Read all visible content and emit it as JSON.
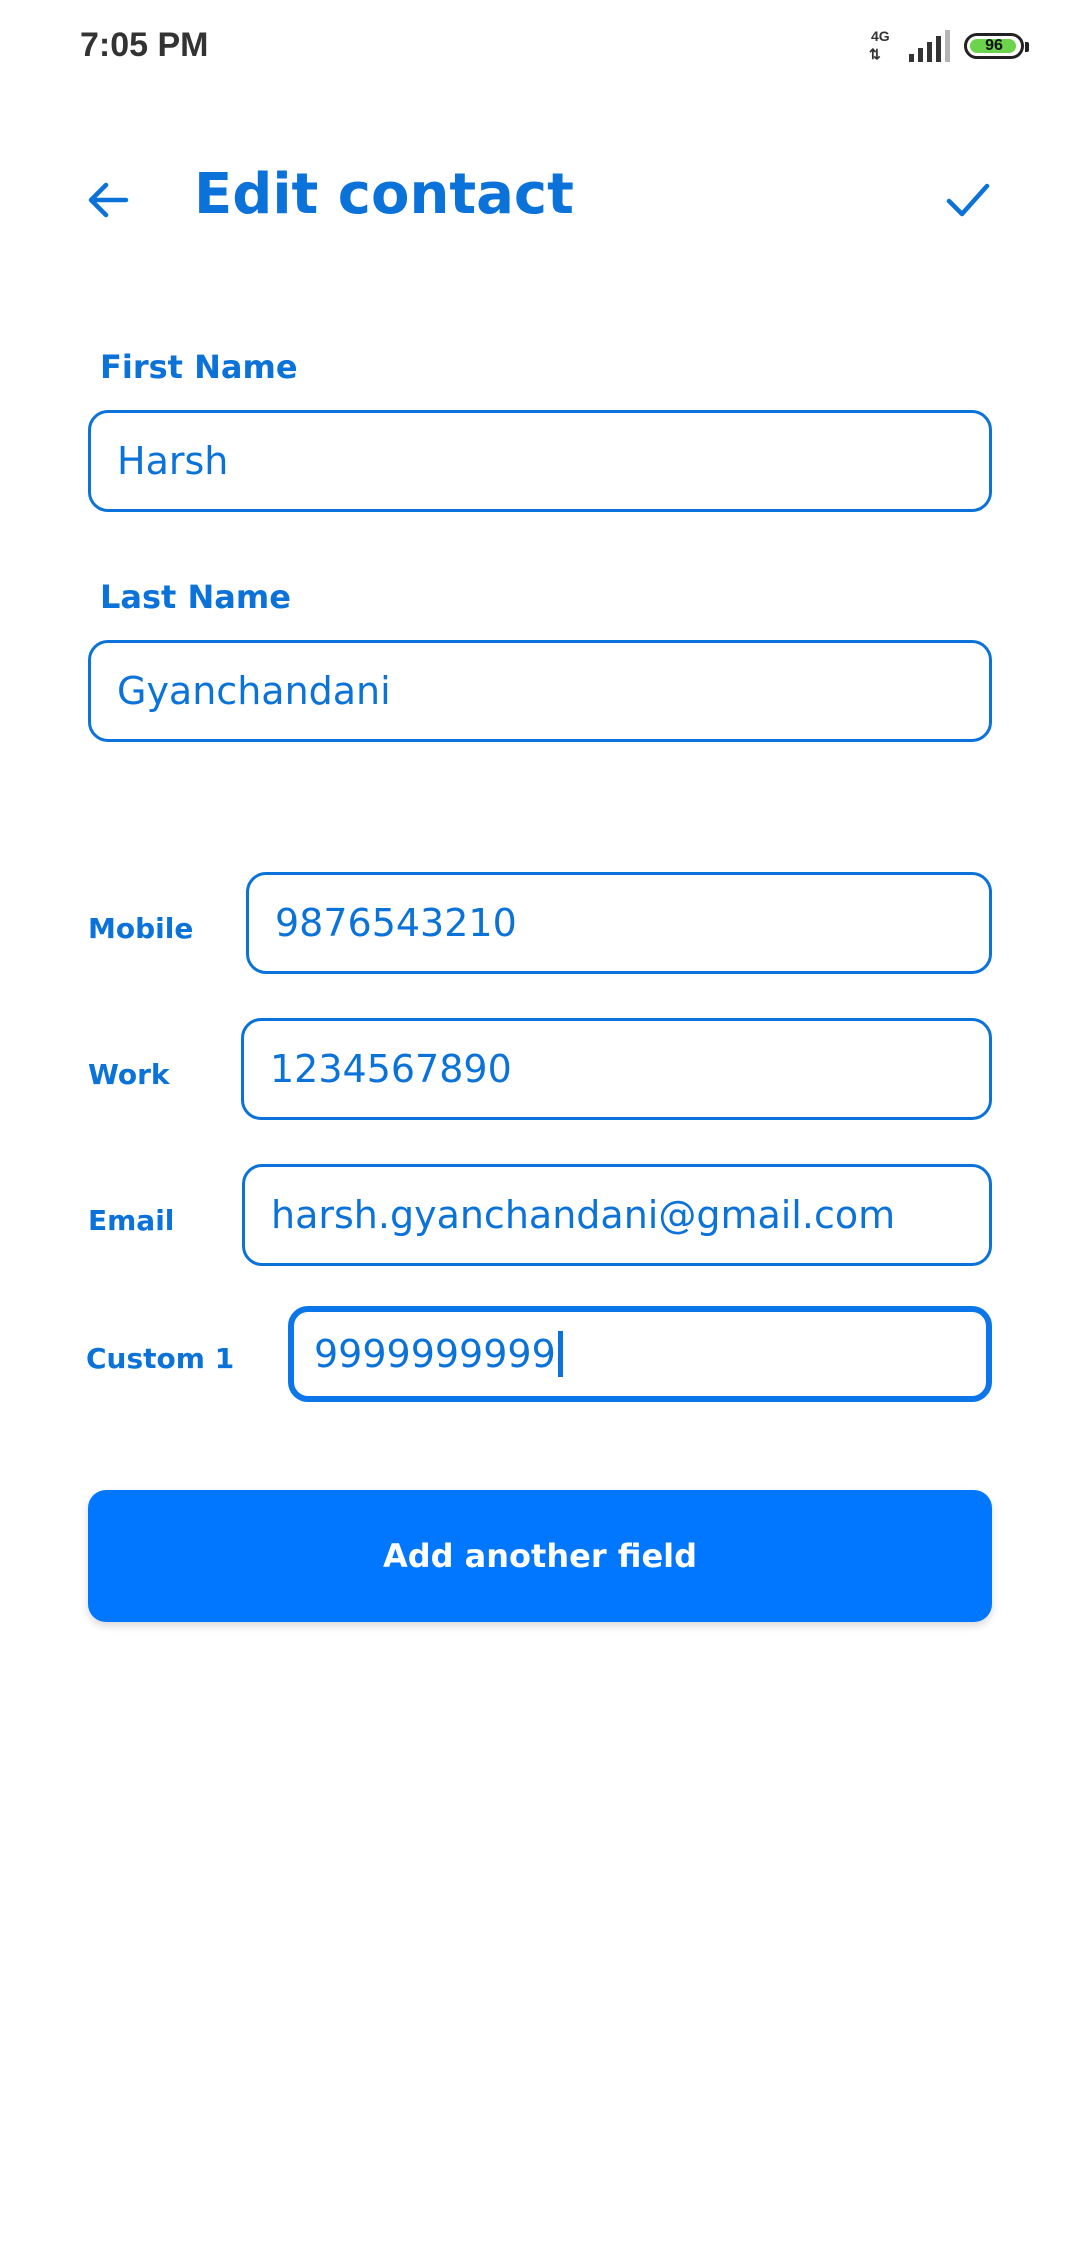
{
  "status_bar": {
    "time": "7:05 PM",
    "network_type": "4G",
    "network_arrows": "⇅",
    "battery_level": "96",
    "battery_percent": 96,
    "icons": [
      "signal-icon",
      "battery-icon"
    ]
  },
  "header": {
    "title": "Edit contact",
    "back_icon": "back-arrow-icon",
    "save_icon": "checkmark-icon"
  },
  "form": {
    "first_name": {
      "label": "First Name",
      "value": "Harsh"
    },
    "last_name": {
      "label": "Last Name",
      "value": "Gyanchandani"
    },
    "fields": [
      {
        "label": "Mobile",
        "value": "9876543210"
      },
      {
        "label": "Work",
        "value": "1234567890"
      },
      {
        "label": "Email",
        "value": "harsh.gyanchandani@gmail.com"
      },
      {
        "label": "Custom 1",
        "value": "9999999999",
        "focused": true
      }
    ]
  },
  "add_field_button": {
    "label": "Add another field"
  },
  "colors": {
    "accent": "#0a72d8",
    "button": "#0077fe",
    "battery": "#6cd44a"
  }
}
